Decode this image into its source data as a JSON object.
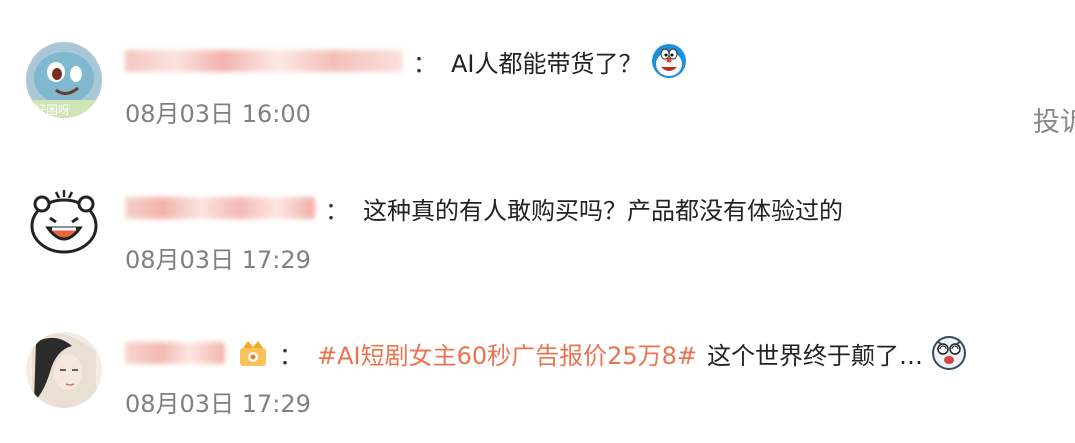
{
  "comments": [
    {
      "avatar": "squirtle-avatar",
      "text": "AI人都能带货了？",
      "emoji": "doraemon-emoji",
      "time": "08月03日 16:00"
    },
    {
      "avatar": "cartoon-bear-avatar",
      "text": "这种真的有人敢购买吗？产品都没有体验过的",
      "time": "08月03日 17:29"
    },
    {
      "avatar": "portrait-avatar",
      "badge": "vip-badge-icon",
      "hashtag": "#AI短剧女主60秒广告报价25万8#",
      "text": "这个世界终于颠了…",
      "emoji": "dizzy-face-emoji",
      "time": "08月03日 17:29"
    }
  ],
  "separator": "：",
  "side_action_label": "投诉",
  "colors": {
    "hashtag": "#eb7350",
    "timestamp": "#808080",
    "blurred_name": "#f2b8b3"
  }
}
